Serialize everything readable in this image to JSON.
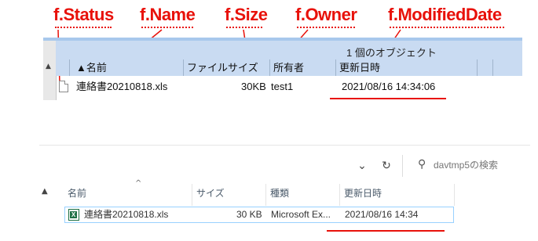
{
  "annotations": {
    "status": "f.Status",
    "name": "f.Name",
    "size": "f.Size",
    "owner": "f.Owner",
    "modified": "f.ModifiedDate",
    "color": "#e8110a"
  },
  "explorer_old": {
    "status_text": "1 個のオブジェクト",
    "columns": {
      "name": "▲名前",
      "size": "ファイルサイズ",
      "owner": "所有者",
      "modified": "更新日時"
    },
    "file": {
      "icon": "document-icon",
      "name": "連絡書20210818.xls",
      "size": "30KB",
      "owner": "test1",
      "modified": "2021/08/16 14:34:06"
    }
  },
  "explorer_new": {
    "toolbar": {
      "dropdown_icon": "chevron-down-icon",
      "refresh_icon": "refresh-icon",
      "search_icon": "search-icon",
      "search_placeholder": "davtmp5の検索"
    },
    "columns": {
      "name": "名前",
      "size": "サイズ",
      "type": "種類",
      "modified": "更新日時"
    },
    "file": {
      "icon": "excel-file-icon",
      "name": "連絡書20210818.xls",
      "size": "30 KB",
      "type": "Microsoft Ex...",
      "modified": "2021/08/16 14:34"
    }
  }
}
